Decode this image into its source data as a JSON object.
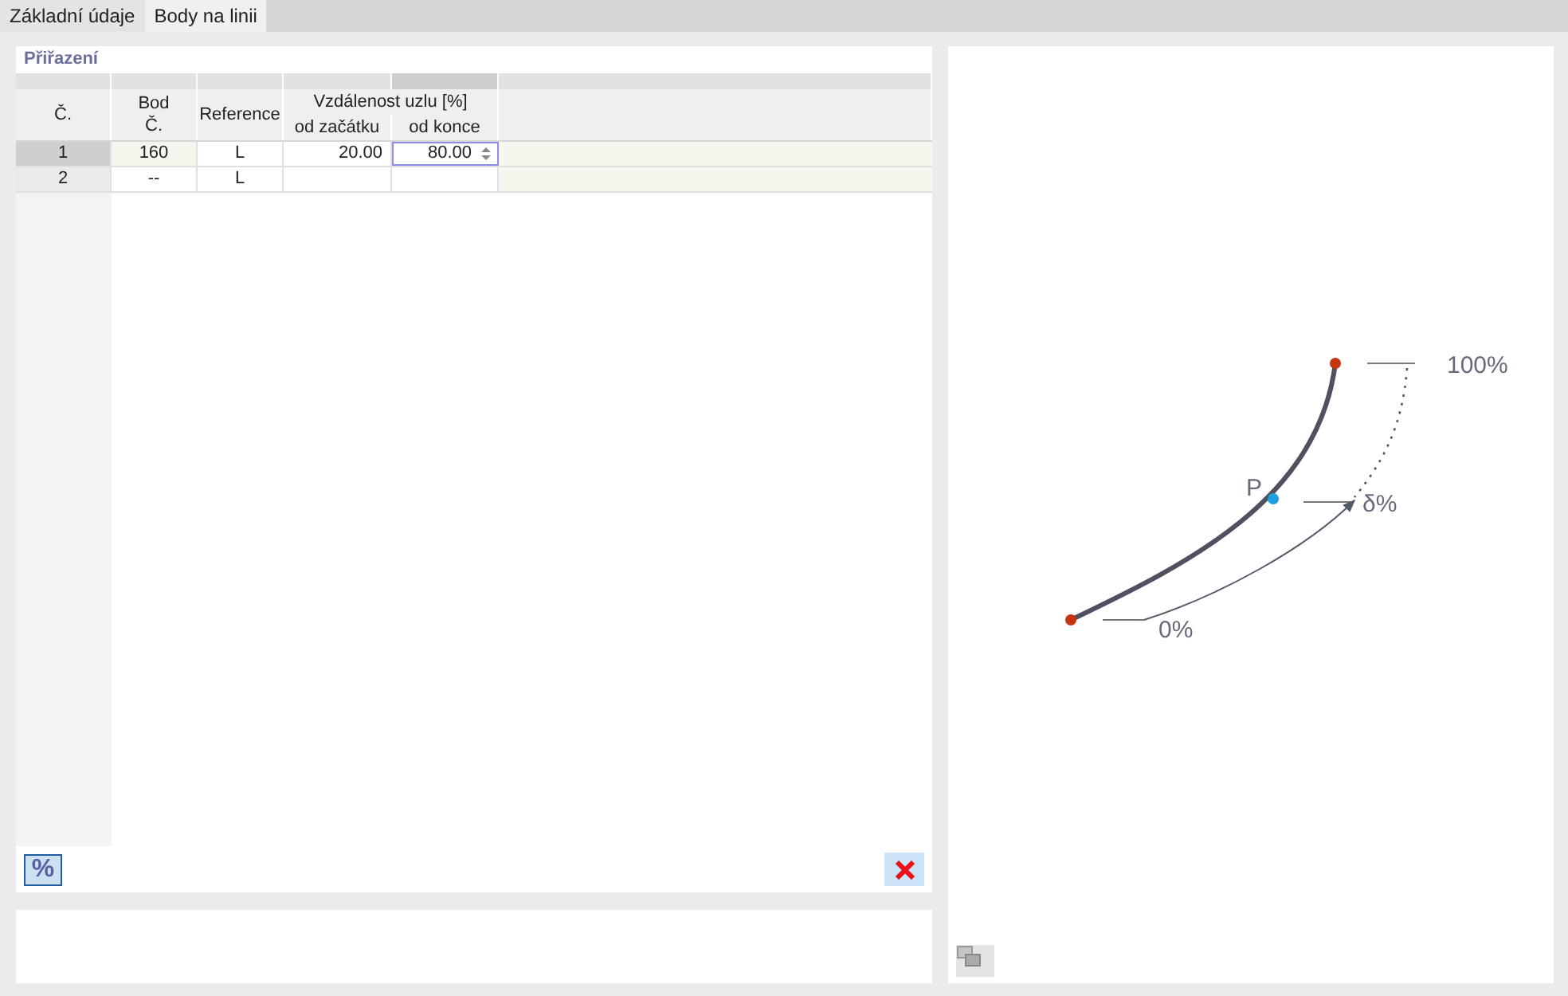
{
  "tabs": [
    {
      "label": "Základní údaje",
      "selected": false
    },
    {
      "label": "Body na linii",
      "selected": true
    }
  ],
  "assignment": {
    "title": "Přiřazení",
    "columns": {
      "row_header": "Č.",
      "point": [
        "Bod",
        "Č."
      ],
      "reference": "Reference",
      "distance_group": "Vzdálenost uzlu [%]",
      "from_start": "od začátku",
      "from_end": "od konce"
    },
    "rows": [
      {
        "number": "1",
        "point": "160",
        "reference": "L",
        "from_start": "20.00",
        "from_end": "80.00",
        "selected": true,
        "editing": true
      },
      {
        "number": "2",
        "point": "--",
        "reference": "L",
        "from_start": "",
        "from_end": "",
        "selected": false,
        "editing": false
      }
    ],
    "percent_button": {
      "label": "%",
      "on": true
    }
  },
  "diagram": {
    "point_label": "P",
    "end_label": "100%",
    "point_distance_label": "δ%",
    "start_label": "0%"
  }
}
